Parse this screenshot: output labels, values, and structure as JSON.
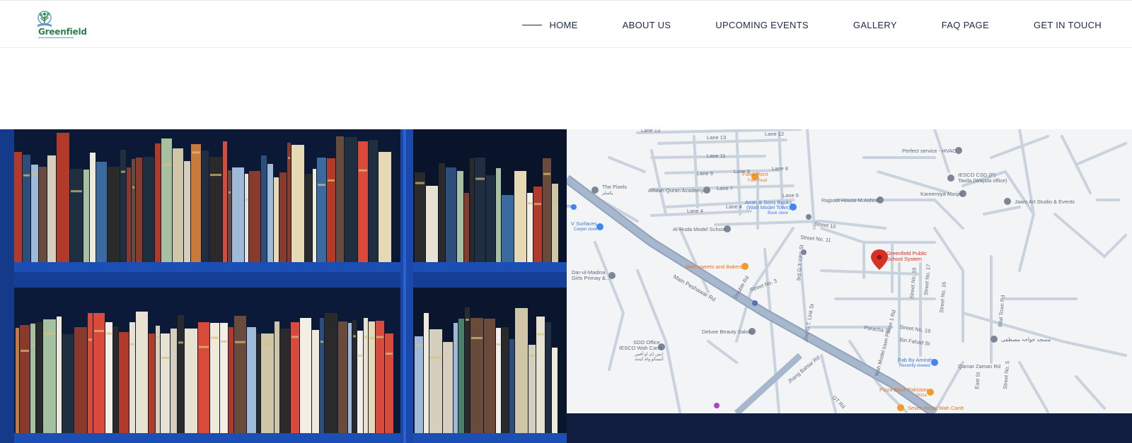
{
  "brand": {
    "name": "Greenfield",
    "logo_icon": "tree-book-icon"
  },
  "nav": {
    "items": [
      {
        "label": "HOME",
        "active": true
      },
      {
        "label": "ABOUT US",
        "active": false
      },
      {
        "label": "UPCOMING EVENTS",
        "active": false
      },
      {
        "label": "GALLERY",
        "active": false
      },
      {
        "label": "FAQ PAGE",
        "active": false
      },
      {
        "label": "GET IN TOUCH",
        "active": false
      }
    ]
  },
  "colors": {
    "navy": "#1d2a4a",
    "footer": "#121e3f",
    "brand_green": "#2e7d4f",
    "shelf_blue": "#1c4fb5",
    "map_road": "#c9d3de",
    "map_main_road": "#8fa3bd",
    "map_pin": "#d93025"
  },
  "map": {
    "pin_label": [
      "Greenfield Public",
      "School System"
    ],
    "streets": {
      "lane13": "Lane 13",
      "lane12": "Lane 12",
      "lane11": "Lane 11",
      "lane9a": "Lane 9",
      "lane9b": "Lane 9",
      "lane8": "Lane 8",
      "lane7": "Lane 7",
      "lane5": "Lane 5",
      "lane4a": "Lane 4",
      "lane4b": "Lane 4",
      "street10": "Street 10",
      "street11": "Street No. 11",
      "main_peshawar": "Main Peshawar Rd",
      "double_rd": "Double Rd",
      "street3": "Street No. 3",
      "street19": "Street No. 19",
      "third_link": "3rd G.T. Link St",
      "second_link": "2nd G.T. Link St",
      "paracha": "Paracha St",
      "bin_fahad": "Bin Fahad St",
      "wah_model": "Wah Model town Phase 1 Rd",
      "street18": "Street No. 18",
      "street17": "Street No. 17",
      "street16": "Street No. 16",
      "bilal_town": "Bilal Town Rd",
      "qamar_zaman": "Qamar Zaman Rd",
      "east_st": "East St",
      "st5": "Street No. 5",
      "jhang": "Jhang Bahtar Rd",
      "gt_rd": "GT Rd"
    },
    "places": {
      "food_point": [
        "Food Point",
        "Fast Food"
      ],
      "perfect_service": "Perfect service - HVAC",
      "iesco": [
        "IESCO CSD (P)",
        "Taxila (Wapda office)"
      ],
      "kareemiya": "Kareemiya Masjid",
      "jaam_art": "Jaam Art Studio & Events",
      "the_pixels": [
        "The Pixels",
        "پکسلز"
      ],
      "alfalah": "Alfalah Quran Academy",
      "amin_books": [
        "Amin & Sons Books",
        "(Wah Model Town)",
        "Book store"
      ],
      "rajpoot": "Rajpoot House M.Ashraf",
      "v_surfaces": [
        "V Surfaces",
        "Carpet store"
      ],
      "alhuda": "Al-Huda Model School",
      "dar_madina": [
        "Dar-ul-Madina",
        "Girls Primay &..."
      ],
      "wah_sweets": "Wah sweets and Bakers",
      "deluxe": "Deluxe Beauty Salon",
      "sdo": [
        "SDO Office",
        "IESCO Wah Cantt",
        "ایس ڈی او آفس",
        "آئیسکو واہ کینٹ"
      ],
      "fab_amirah": [
        "Fab By Amirah",
        "Recently viewed"
      ],
      "pizza_base": [
        "Pizza Base Pakistan",
        "Pizza"
      ],
      "seven_foods": "Seven foods Wah Cantt",
      "masjid_urdu": "مسجد خواجہ مصطفی",
      "mp_edge": "mp"
    }
  }
}
